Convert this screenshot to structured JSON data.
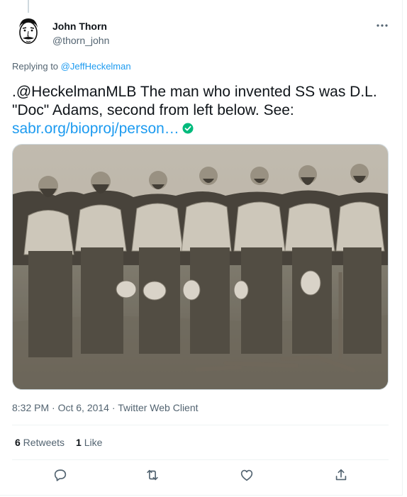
{
  "author": {
    "name": "John Thorn",
    "handle": "@thorn_john"
  },
  "reply": {
    "prefix": "Replying to ",
    "to": "@JeffHeckelman"
  },
  "tweet": {
    "line1": ".@HeckelmanMLB The man who invented SS was D.L.",
    "line2": "\"Doc\" Adams, second from left below. See:",
    "link": "sabr.org/bioproj/person…"
  },
  "meta": {
    "time": "8:32 PM",
    "sep1": " · ",
    "date": "Oct 6, 2014",
    "sep2": " · ",
    "client": "Twitter Web Client"
  },
  "stats": {
    "retweets_count": "6",
    "retweets_label": " Retweets",
    "likes_count": "1",
    "likes_label": " Like"
  },
  "icons": {
    "more": "more-horizontal-icon",
    "reply": "reply-icon",
    "retweet": "retweet-icon",
    "like": "like-icon",
    "share": "share-icon",
    "verified": "check-badge-icon"
  },
  "colors": {
    "link": "#1d9bf0",
    "secondary_text": "#536471",
    "primary_text": "#0f1419",
    "verified_badge": "#00ba7c"
  }
}
